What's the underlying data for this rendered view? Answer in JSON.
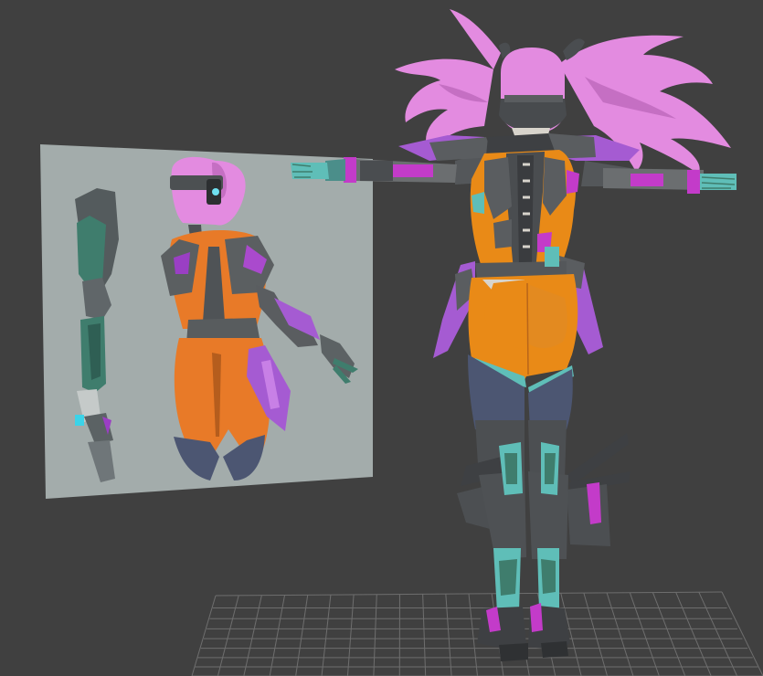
{
  "viewport": {
    "background": "#404040",
    "grid_color": "#6e6e6e",
    "reference_plane_color": "#a3acab"
  },
  "palette": {
    "hair": "#e38be0",
    "hair_shade": "#c56fc3",
    "suit_orange": "#e98a17",
    "armor_gray": "#5a5d60",
    "armor_dark": "#3e4043",
    "accent_magenta": "#c33bc9",
    "accent_purple": "#a55bd2",
    "teal": "#5fbeb8",
    "legs_navy": "#4c5672",
    "ref_teal": "#3f7d6d",
    "ref_orange": "#e87a28"
  },
  "objects": [
    {
      "name": "reference-image-plane",
      "kind": "plane",
      "icon": "image-plane"
    },
    {
      "name": "character-model",
      "kind": "mesh",
      "icon": "mesh"
    },
    {
      "name": "home-grid",
      "kind": "grid",
      "icon": "grid"
    }
  ]
}
